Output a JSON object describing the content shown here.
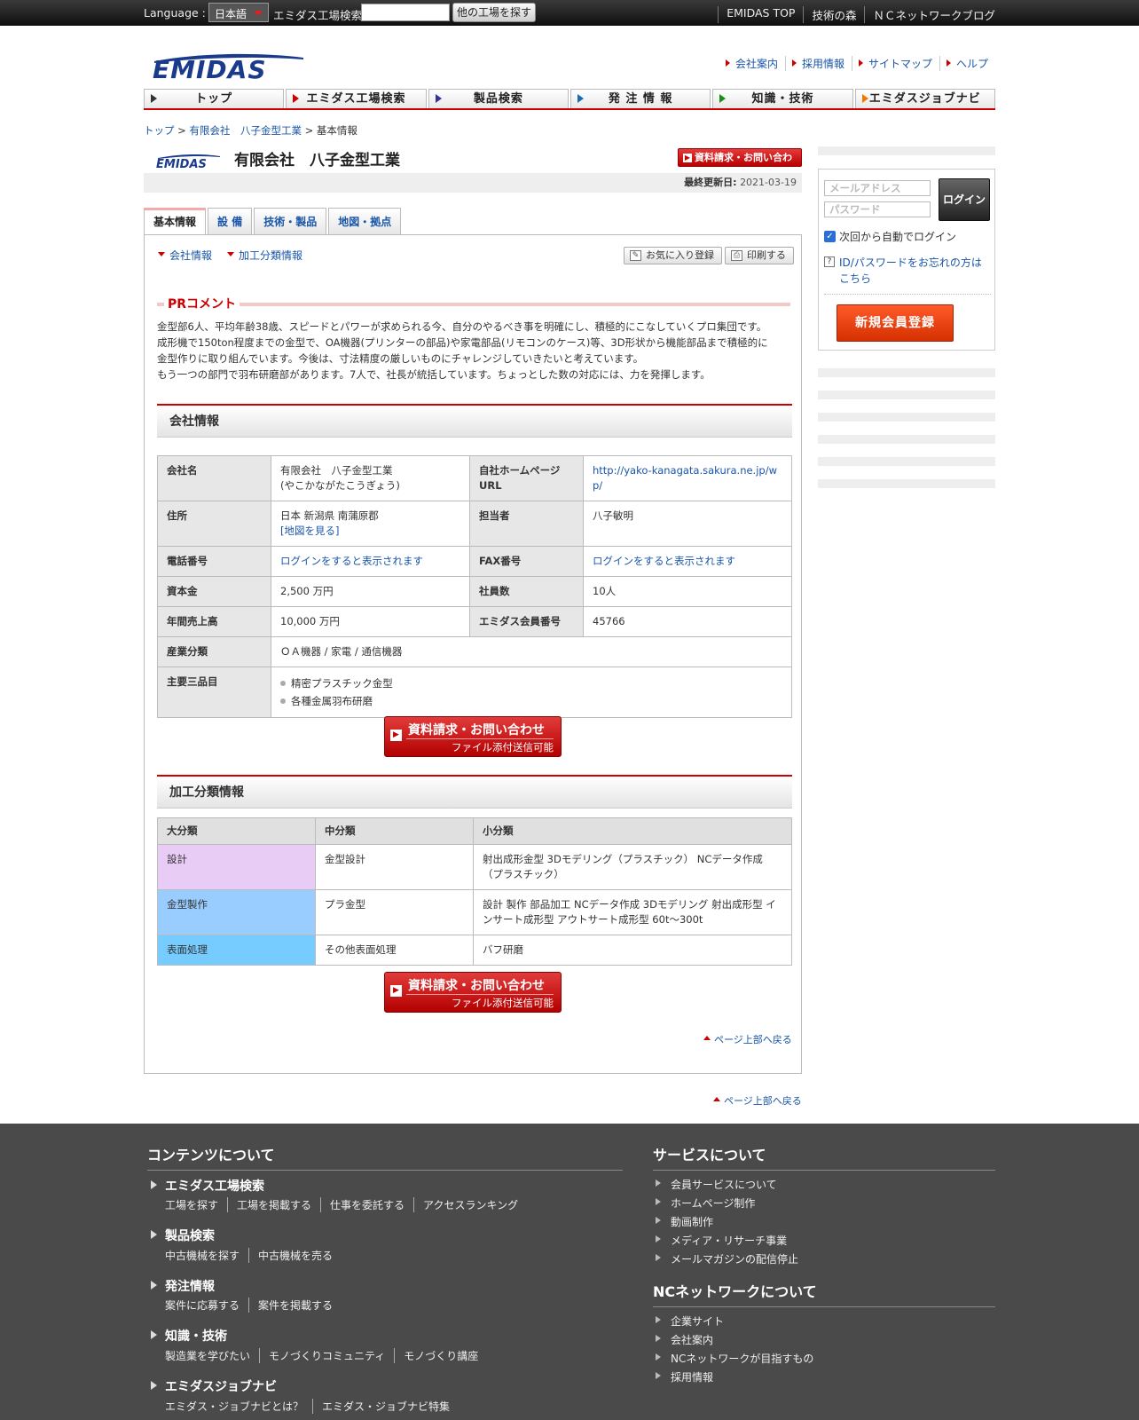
{
  "topbar": {
    "language_label": "Language :",
    "language_value": "日本語",
    "search_label": "エミダス工場検索",
    "search_button": "他の工場を探す",
    "links": [
      "EMIDAS TOP",
      "技術の森",
      "ＮＣネットワークブログ"
    ]
  },
  "header": {
    "logo_text": "EMIDAS",
    "links": [
      "会社案内",
      "採用情報",
      "サイトマップ",
      "ヘルプ"
    ]
  },
  "gnav": [
    "トップ",
    "エミダス工場検索",
    "製品検索",
    "発 注 情 報",
    "知識・技術",
    "エミダスジョブナビ"
  ],
  "gnav_colors": [
    "#333333",
    "#cc0000",
    "#333399",
    "#1a6bb0",
    "#1a8c1a",
    "#f07800"
  ],
  "breadcrumb": {
    "top": "トップ",
    "sep": " > ",
    "company": "有限会社　八子金型工業",
    "current": "基本情報"
  },
  "company": {
    "name": "有限会社　八子金型工業",
    "inquiry_small": "資料請求・お問い合わせ",
    "updated_label": "最終更新日:",
    "updated_value": "2021-03-19"
  },
  "tabs": [
    "基本情報",
    "設 備",
    "技術・製品",
    "地図・拠点"
  ],
  "subnav": [
    "会社情報",
    "加工分類情報"
  ],
  "tools": {
    "favorite": "お気に入り登録",
    "print": "印刷する"
  },
  "pr": {
    "heading": "PRコメント",
    "text": "金型部6人、平均年齢38歳、スピードとパワーが求められる今、自分のやるべき事を明確にし、積極的にこなしていくプロ集団です。\n成形機で150ton程度までの金型で、OA機器(プリンターの部品)や家電部品(リモコンのケース)等、3D形状から機能部品まで積極的に\n金型作りに取り組んでいます。今後は、寸法精度の厳しいものにチャレンジしていきたいと考えています。\nもう一つの部門で羽布研磨部があります。7人で、社長が統括しています。ちょっとした数の対応には、力を発揮します。"
  },
  "company_info": {
    "heading": "会社情報",
    "name_label": "会社名",
    "name_value": "有限会社　八子金型工業",
    "name_kana": "(やこかながたこうぎょう)",
    "url_label": "自社ホームページURL",
    "url_value": "http://yako-kanagata.sakura.ne.jp/wp/",
    "address_label": "住所",
    "address_value": "日本 新潟県 南蒲原郡",
    "map_link": "[地図を見る]",
    "contact_label": "担当者",
    "contact_value": "八子敏明",
    "phone_label": "電話番号",
    "phone_value": "ログインをすると表示されます",
    "fax_label": "FAX番号",
    "fax_value": "ログインをすると表示されます",
    "capital_label": "資本金",
    "capital_value": "2,500 万円",
    "employees_label": "社員数",
    "employees_value": "10人",
    "sales_label": "年間売上高",
    "sales_value": "10,000 万円",
    "member_label": "エミダス会員番号",
    "member_value": "45766",
    "industry_label": "産業分類",
    "industry_value": "ＯＡ機器 / 家電 / 通信機器",
    "products_label": "主要三品目",
    "products": [
      "精密プラスチック金型",
      "各種金属羽布研磨"
    ]
  },
  "inquiry_big": {
    "line1": "資料請求・お問い合わせ",
    "line2": "ファイル添付送信可能"
  },
  "processing": {
    "heading": "加工分類情報",
    "headers": [
      "大分類",
      "中分類",
      "小分類"
    ],
    "rows": [
      {
        "major": "設計",
        "middle": "金型設計",
        "minor": "射出成形金型  3Dモデリング（プラスチック）  NCデータ作成（プラスチック）",
        "color": "#e8ccf5"
      },
      {
        "major": "金型製作",
        "middle": "プラ金型",
        "minor": "設計  製作  部品加工  NCデータ作成  3Dモデリング  射出成形型  インサート成形型  アウトサート成形型  60t〜300t",
        "color": "#99ccff"
      },
      {
        "major": "表面処理",
        "middle": "その他表面処理",
        "minor": "バフ研磨",
        "color": "#77ccff"
      }
    ]
  },
  "page_top": "ページ上部へ戻る",
  "login": {
    "email_placeholder": "メールアドレス",
    "password_placeholder": "パスワード",
    "login_button": "ログイン",
    "auto_login": "次回から自動でログイン",
    "forgot": "ID/パスワードをお忘れの方はこちら",
    "register": "新規会員登録"
  },
  "footer": {
    "contents_heading": "コンテンツについて",
    "categories": [
      {
        "title": "エミダス工場検索",
        "links": [
          "工場を探す",
          "工場を掲載する",
          "仕事を委託する",
          "アクセスランキング"
        ]
      },
      {
        "title": "製品検索",
        "links": [
          "中古機械を探す",
          "中古機械を売る"
        ]
      },
      {
        "title": "発注情報",
        "links": [
          "案件に応募する",
          "案件を掲載する"
        ]
      },
      {
        "title": "知識・技術",
        "links": [
          "製造業を学びたい",
          "モノづくりコミュニティ",
          "モノづくり講座"
        ]
      },
      {
        "title": "エミダスジョブナビ",
        "links": [
          "エミダス・ジョブナビとは？",
          "エミダス・ジョブナビ特集"
        ]
      }
    ],
    "service_heading": "サービスについて",
    "services": [
      "会員サービスについて",
      "ホームページ制作",
      "動画制作",
      "メディア・リサーチ事業",
      "メールマガジンの配信停止"
    ],
    "nc_heading": "NCネットワークについて",
    "nc_items": [
      "企業サイト",
      "会社案内",
      "NCネットワークが目指すもの",
      "採用情報"
    ]
  }
}
